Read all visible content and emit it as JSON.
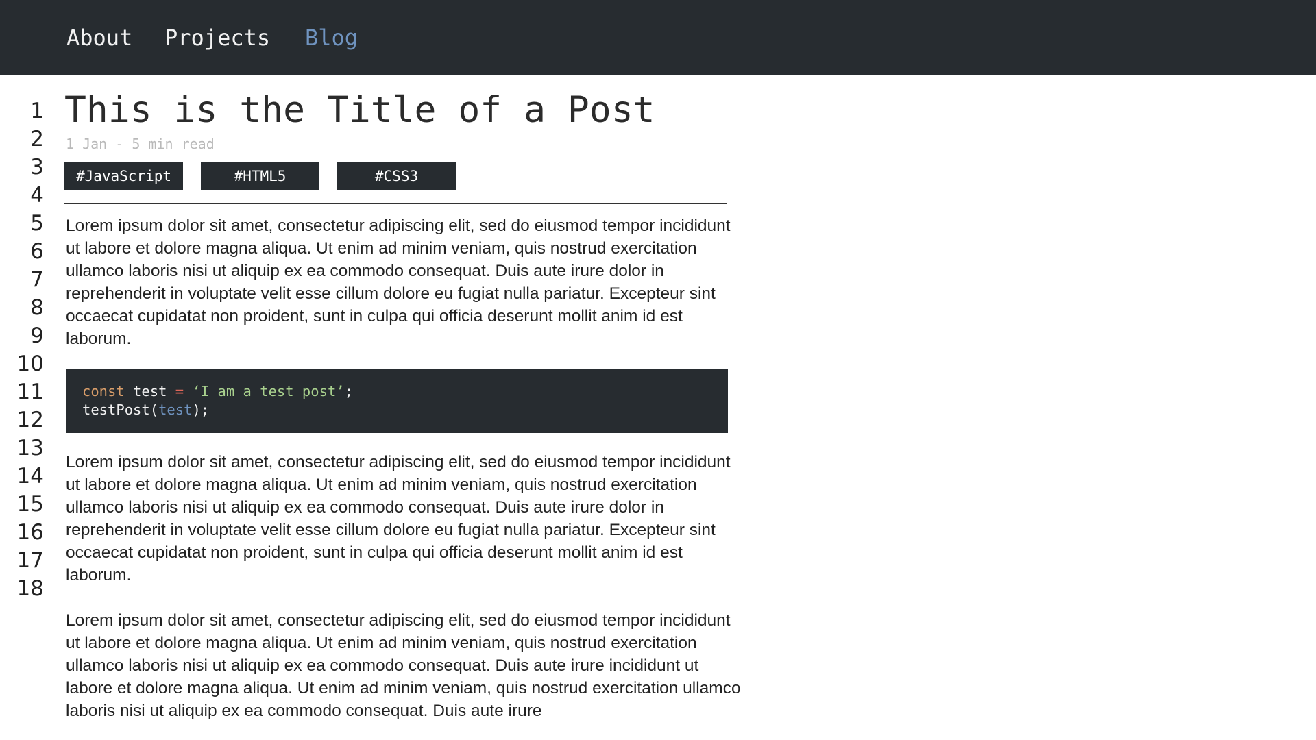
{
  "nav": {
    "items": [
      {
        "label": "About"
      },
      {
        "label": "Projects"
      },
      {
        "label": "Blog"
      }
    ],
    "active_item": "Blog",
    "active_color": "#6f93bf",
    "background_color": "#272c30"
  },
  "gutter": {
    "line_numbers": [
      "1",
      "2",
      "3",
      "4",
      "5",
      "6",
      "7",
      "8",
      "9",
      "10",
      "11",
      "12",
      "13",
      "14",
      "15",
      "16",
      "17",
      "18"
    ]
  },
  "post": {
    "title": "This is the Title of a Post",
    "meta": "1 Jan - 5 min read",
    "tags": [
      "#JavaScript",
      "#HTML5",
      "#CSS3"
    ],
    "paragraphs": [
      "Lorem ipsum dolor sit amet, consectetur adipiscing elit, sed do eiusmod tempor incididunt ut labore et dolore magna aliqua. Ut enim ad minim veniam, quis nostrud exercitation ullamco laboris nisi ut aliquip ex ea commodo consequat. Duis aute irure dolor in reprehenderit in voluptate velit esse cillum dolore eu fugiat nulla pariatur. Excepteur sint occaecat cupidatat non proident, sunt in culpa qui officia deserunt mollit anim id est laborum.",
      "Lorem ipsum dolor sit amet, consectetur adipiscing elit, sed do eiusmod tempor incididunt ut labore et dolore magna aliqua. Ut enim ad minim veniam, quis nostrud exercitation ullamco laboris nisi ut aliquip ex ea commodo consequat. Duis aute irure dolor in reprehenderit in voluptate velit esse cillum dolore eu fugiat nulla pariatur. Excepteur sint occaecat cupidatat non proident, sunt in culpa qui officia deserunt mollit anim id est laborum.",
      "Lorem ipsum dolor sit amet, consectetur adipiscing elit, sed do eiusmod tempor incididunt ut labore et dolore magna aliqua. Ut enim ad minim veniam, quis nostrud exercitation ullamco laboris nisi ut aliquip ex ea commodo consequat. Duis aute irure incididunt ut labore et dolore magna aliqua. Ut enim ad minim veniam, quis nostrud exercitation ullamco laboris nisi ut aliquip ex ea commodo consequat. Duis aute irure"
    ],
    "code": {
      "line1": {
        "keyword": "const",
        "identifier": " test ",
        "operator": "=",
        "string": " ‘I am a test post’",
        "end": ";"
      },
      "line2": {
        "call": "testPost(",
        "arg": "test",
        "end": ");"
      },
      "colors": {
        "keyword": "#d99e6a",
        "operator": "#e0675a",
        "string": "#a9d18e",
        "variable": "#6f93bf"
      }
    }
  }
}
